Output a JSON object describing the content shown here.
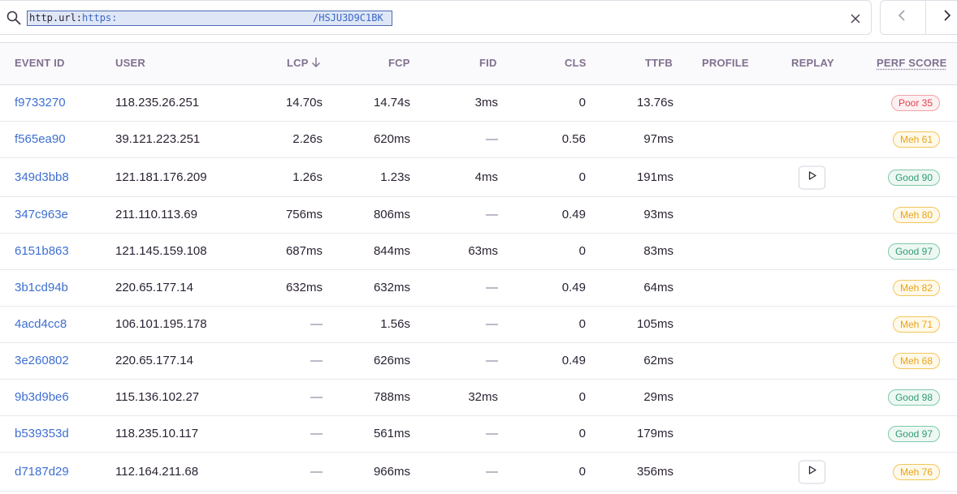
{
  "search": {
    "key": "http.url",
    "colon": ":",
    "value_start": "https:",
    "value_end": "/HSJU3D9C1BK"
  },
  "icons": {
    "search": "search-icon",
    "clear": "close-icon",
    "prev": "chevron-left-icon",
    "next": "chevron-right-icon",
    "sort": "arrow-down-icon",
    "replay": "play-icon"
  },
  "columns": {
    "event_id": "EVENT ID",
    "user": "USER",
    "lcp": "LCP",
    "fcp": "FCP",
    "fid": "FID",
    "cls": "CLS",
    "ttfb": "TTFB",
    "profile": "PROFILE",
    "replay": "REPLAY",
    "perf_score": "PERF SCORE"
  },
  "rows": [
    {
      "id": "f9733270",
      "user": "118.235.26.251",
      "lcp": "14.70s",
      "fcp": "14.74s",
      "fid": "3ms",
      "cls": "0",
      "ttfb": "13.76s",
      "replay": false,
      "score_label": "Poor 35",
      "score_class": "poor"
    },
    {
      "id": "f565ea90",
      "user": "39.121.223.251",
      "lcp": "2.26s",
      "fcp": "620ms",
      "fid": "—",
      "cls": "0.56",
      "ttfb": "97ms",
      "replay": false,
      "score_label": "Meh 61",
      "score_class": "meh"
    },
    {
      "id": "349d3bb8",
      "user": "121.181.176.209",
      "lcp": "1.26s",
      "fcp": "1.23s",
      "fid": "4ms",
      "cls": "0",
      "ttfb": "191ms",
      "replay": true,
      "score_label": "Good 90",
      "score_class": "good"
    },
    {
      "id": "347c963e",
      "user": "211.110.113.69",
      "lcp": "756ms",
      "fcp": "806ms",
      "fid": "—",
      "cls": "0.49",
      "ttfb": "93ms",
      "replay": false,
      "score_label": "Meh 80",
      "score_class": "meh"
    },
    {
      "id": "6151b863",
      "user": "121.145.159.108",
      "lcp": "687ms",
      "fcp": "844ms",
      "fid": "63ms",
      "cls": "0",
      "ttfb": "83ms",
      "replay": false,
      "score_label": "Good 97",
      "score_class": "good"
    },
    {
      "id": "3b1cd94b",
      "user": "220.65.177.14",
      "lcp": "632ms",
      "fcp": "632ms",
      "fid": "—",
      "cls": "0.49",
      "ttfb": "64ms",
      "replay": false,
      "score_label": "Meh 82",
      "score_class": "meh"
    },
    {
      "id": "4acd4cc8",
      "user": "106.101.195.178",
      "lcp": "—",
      "fcp": "1.56s",
      "fid": "—",
      "cls": "0",
      "ttfb": "105ms",
      "replay": false,
      "score_label": "Meh 71",
      "score_class": "meh"
    },
    {
      "id": "3e260802",
      "user": "220.65.177.14",
      "lcp": "—",
      "fcp": "626ms",
      "fid": "—",
      "cls": "0.49",
      "ttfb": "62ms",
      "replay": false,
      "score_label": "Meh 68",
      "score_class": "meh"
    },
    {
      "id": "9b3d9be6",
      "user": "115.136.102.27",
      "lcp": "—",
      "fcp": "788ms",
      "fid": "32ms",
      "cls": "0",
      "ttfb": "29ms",
      "replay": false,
      "score_label": "Good 98",
      "score_class": "good"
    },
    {
      "id": "b539353d",
      "user": "118.235.10.117",
      "lcp": "—",
      "fcp": "561ms",
      "fid": "—",
      "cls": "0",
      "ttfb": "179ms",
      "replay": false,
      "score_label": "Good 97",
      "score_class": "good"
    },
    {
      "id": "d7187d29",
      "user": "112.164.211.68",
      "lcp": "—",
      "fcp": "966ms",
      "fid": "—",
      "cls": "0",
      "ttfb": "356ms",
      "replay": true,
      "score_label": "Meh 76",
      "score_class": "meh"
    }
  ],
  "colors": {
    "link": "#3e6fd1",
    "poor": "#e2414b",
    "meh": "#e8a317",
    "good": "#2f9d72"
  }
}
